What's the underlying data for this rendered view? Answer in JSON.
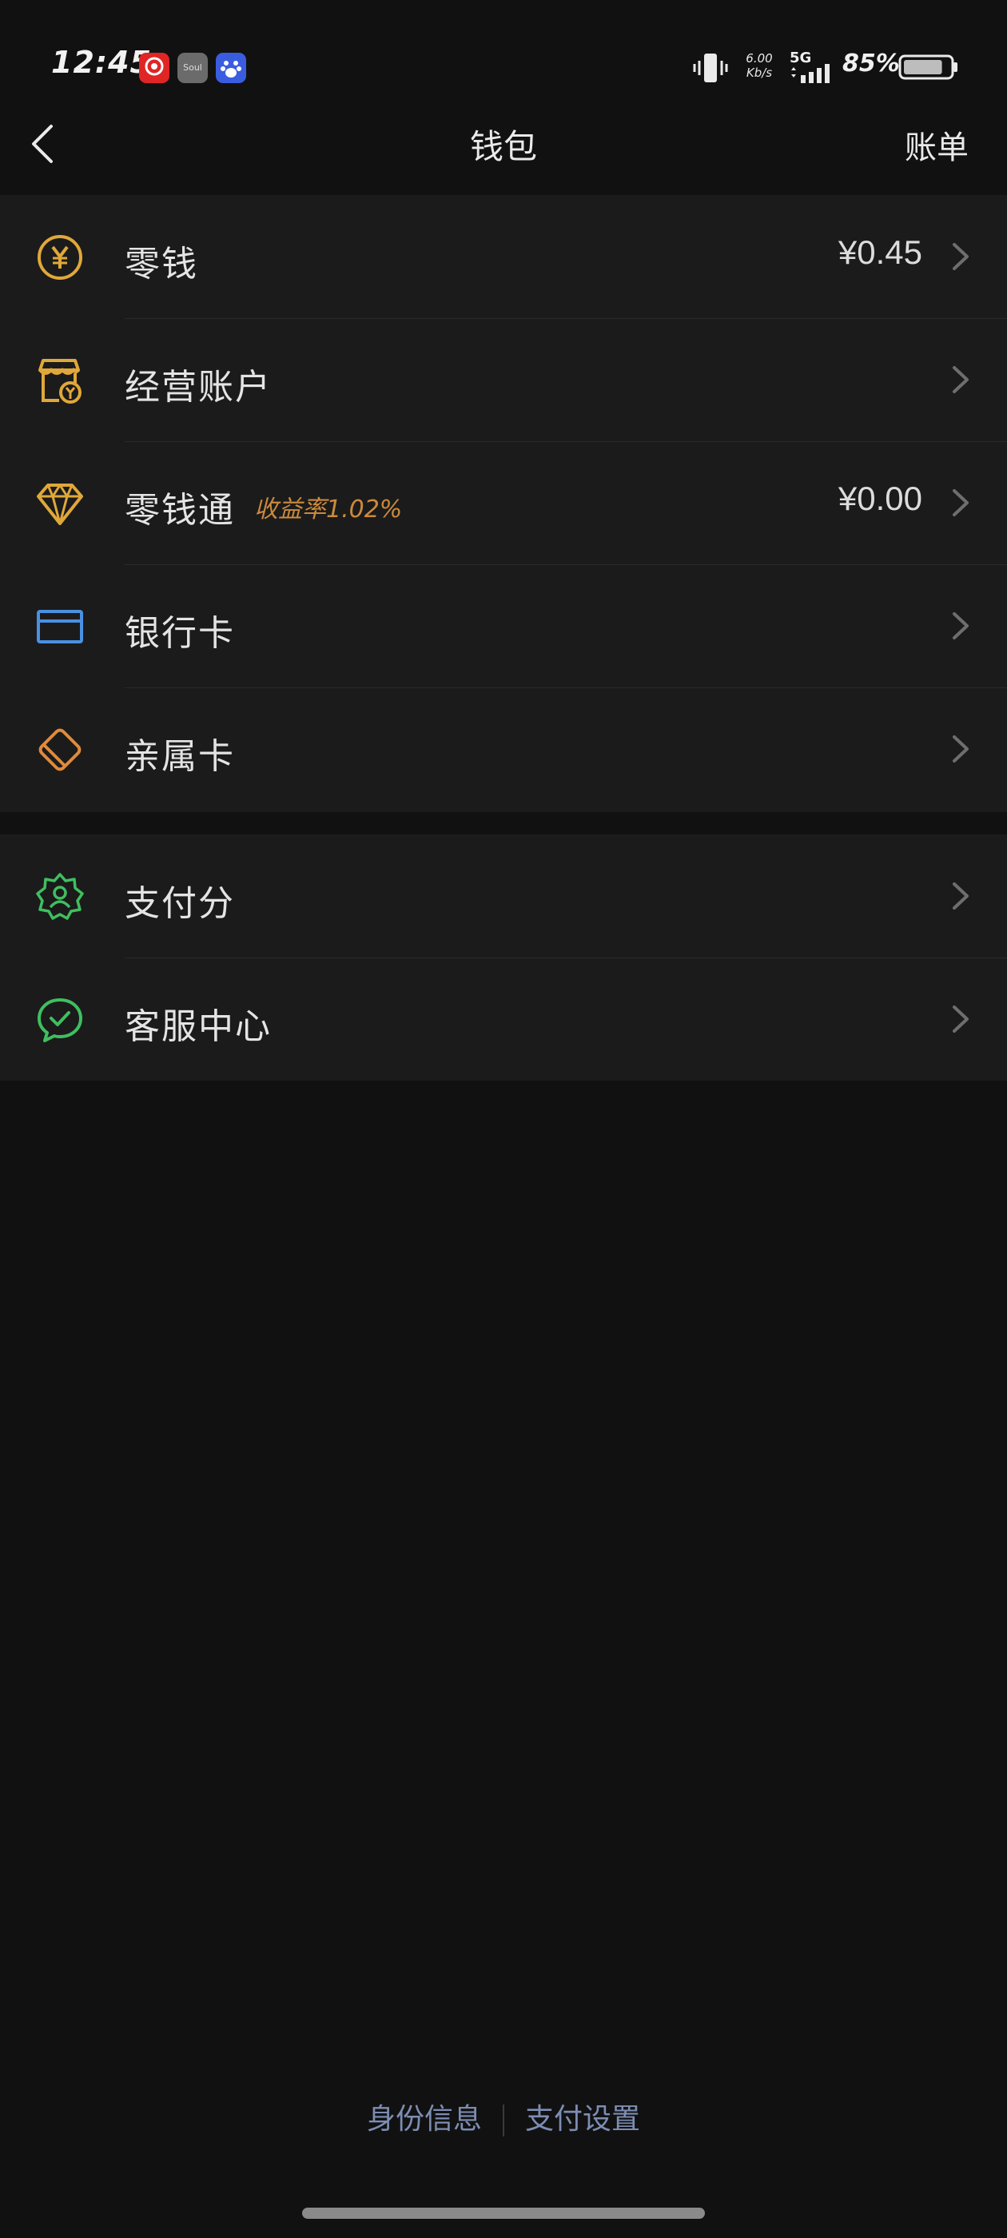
{
  "status_bar": {
    "time": "12:45",
    "apps": [
      "Soul"
    ],
    "net_speed_value": "6.00",
    "net_speed_unit": "Kb/s",
    "network": "5G",
    "battery_percent": "85%",
    "battery_level": 0.85
  },
  "nav": {
    "title": "钱包",
    "right_action": "账单"
  },
  "groups": [
    {
      "items": [
        {
          "label": "零钱",
          "value": "¥0.45",
          "icon": "yuan-coin-icon",
          "color": "#e0a83a"
        },
        {
          "label": "经营账户",
          "icon": "store-icon",
          "color": "#e0a83a"
        },
        {
          "label": "零钱通",
          "badge": "收益率1.02%",
          "value": "¥0.00",
          "icon": "diamond-icon",
          "color": "#e0a83a"
        },
        {
          "label": "银行卡",
          "icon": "bank-card-icon",
          "color": "#4a90e2"
        },
        {
          "label": "亲属卡",
          "icon": "family-card-icon",
          "color": "#e08a3a"
        }
      ]
    },
    {
      "items": [
        {
          "label": "支付分",
          "icon": "pay-score-icon",
          "color": "#3fbf5f"
        },
        {
          "label": "客服中心",
          "icon": "customer-service-icon",
          "color": "#3fbf5f"
        }
      ]
    }
  ],
  "footer": {
    "identity_info": "身份信息",
    "payment_settings": "支付设置"
  },
  "colors": {
    "background": "#111111",
    "surface": "#1b1b1b",
    "accent_gold": "#e0a83a",
    "badge": "#cc8a3c",
    "footer_link": "#7d8db3"
  }
}
